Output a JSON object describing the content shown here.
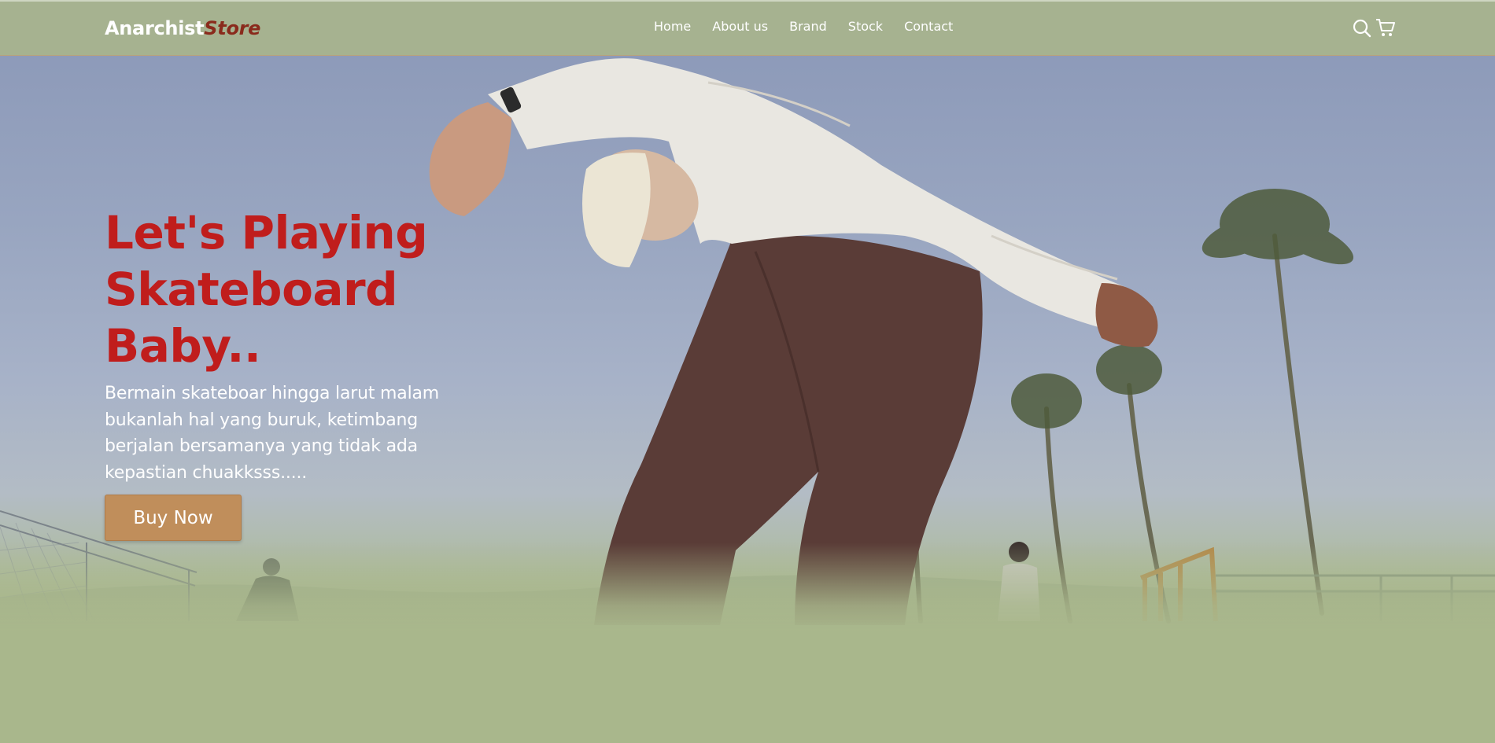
{
  "brand": {
    "name_main": "Anarchist",
    "name_accent": "Store"
  },
  "nav": {
    "links": [
      {
        "label": "Home"
      },
      {
        "label": "About us"
      },
      {
        "label": "Brand"
      },
      {
        "label": "Stock"
      },
      {
        "label": "Contact"
      }
    ],
    "icons": [
      "search-icon",
      "cart-icon"
    ]
  },
  "hero": {
    "headline_line1": "Let's Playing",
    "headline_line2": "Skateboard",
    "headline_line3": "Baby..",
    "subtext": "Bermain skateboar hingga larut malam bukanlah hal yang buruk, ketimbang berjalan bersamanya yang tidak ada kepastian chuakksss.....",
    "cta_label": "Buy Now"
  },
  "colors": {
    "nav_bg": "#a8b48d",
    "headline": "#c01d1c",
    "logo_accent": "#8a2a1c",
    "button_bg": "#c08e5b",
    "page_bg": "#a9b78c"
  }
}
